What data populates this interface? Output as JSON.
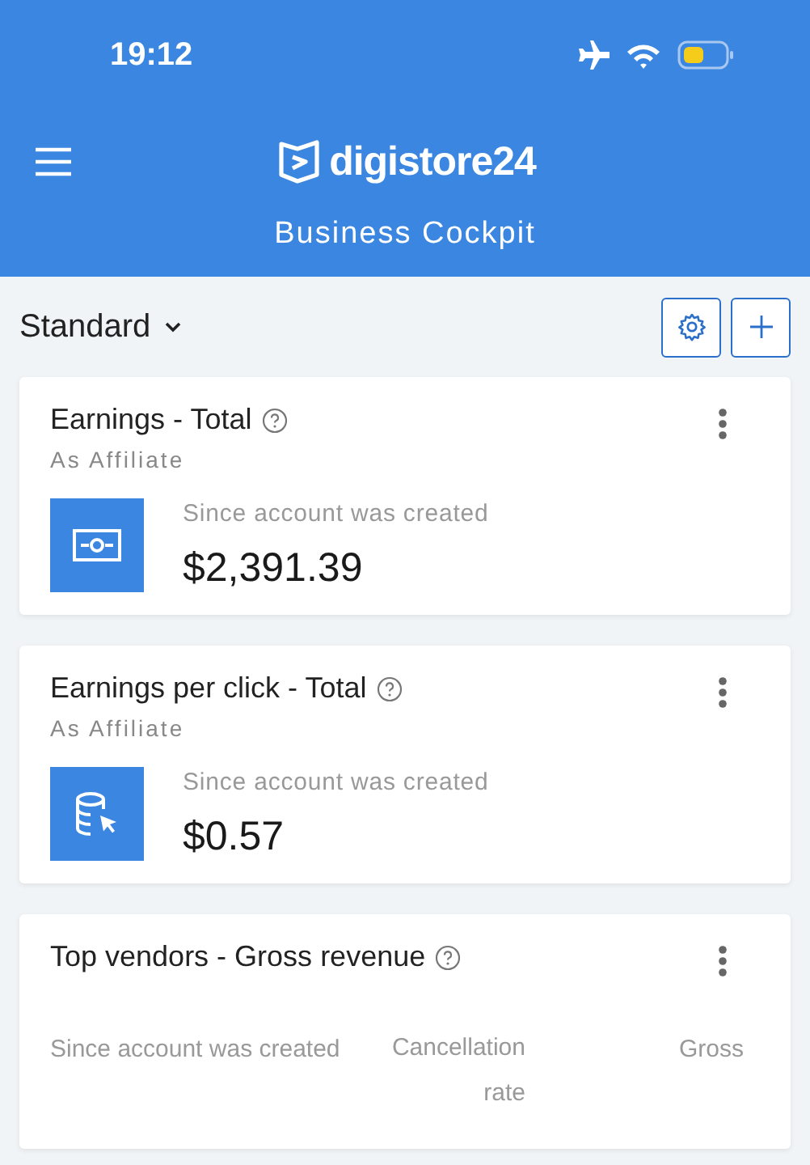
{
  "status_bar": {
    "time": "19:12"
  },
  "header": {
    "logo_text": "digistore24",
    "subtitle": "Business Cockpit"
  },
  "toolbar": {
    "view_label": "Standard"
  },
  "cards": [
    {
      "kind": "money",
      "title": "Earnings - Total",
      "subtitle": "As Affiliate",
      "period": "Since account was created",
      "value": "$2,391.39"
    },
    {
      "kind": "click",
      "title": "Earnings per click - Total",
      "subtitle": "As Affiliate",
      "period": "Since account was created",
      "value": "$0.57"
    }
  ],
  "table_card": {
    "title": "Top vendors - Gross revenue",
    "columns": [
      "Since account was created",
      "Cancellation rate",
      "Gross"
    ]
  }
}
